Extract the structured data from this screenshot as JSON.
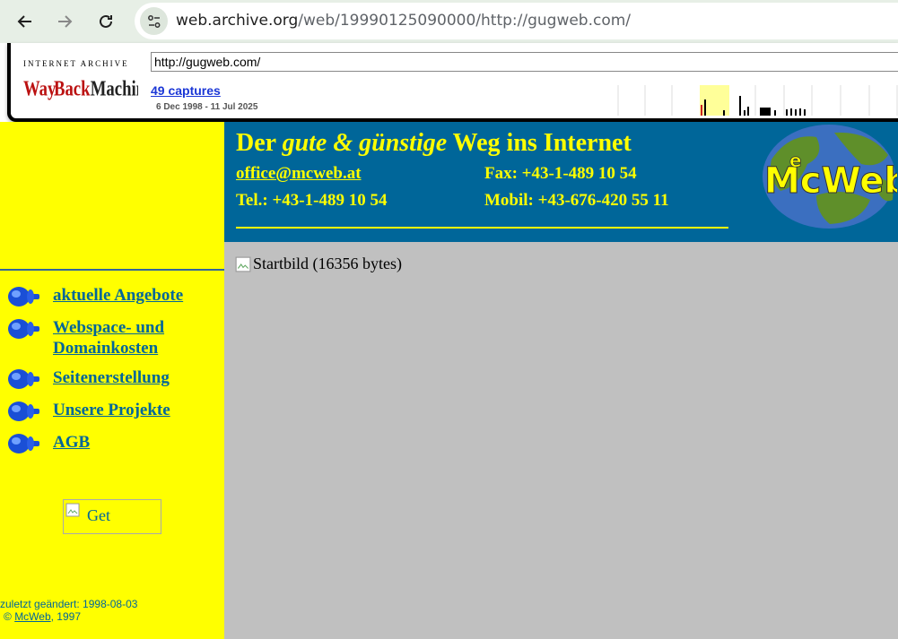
{
  "browser": {
    "url_host": "web.archive.org",
    "url_path": "/web/19990125090000/http://gugweb.com/"
  },
  "wayback": {
    "logo_top": "INTERNET ARCHIVE",
    "logo_alt": "WaybackMachine",
    "url_value": "http://gugweb.com/",
    "captures": "49 captures",
    "range": "6 Dec 1998 - 11 Jul 2025"
  },
  "header": {
    "tagline_pre": "Der ",
    "tagline_em": "gute & günstige",
    "tagline_post": " Weg ins Internet",
    "email": "office@mcweb.at",
    "fax": "Fax: +43-1-489 10 54",
    "tel": "Tel.: +43-1-489 10 54",
    "mobil": "Mobil: +43-676-420 55 11",
    "logo_text": "McWeb",
    "logo_e": "e",
    "colors": {
      "bg": "#006699",
      "text": "#ffff00"
    }
  },
  "nav": {
    "items": [
      {
        "label": "aktuelle Angebote"
      },
      {
        "label": "Webspace- und Domainkosten"
      },
      {
        "label": "Seitenerstellung"
      },
      {
        "label": "Unsere Projekte"
      },
      {
        "label": "AGB"
      }
    ]
  },
  "badge": {
    "alt": "Get Microsoft"
  },
  "main": {
    "image_alt": "Startbild (16356 bytes)"
  },
  "footer": {
    "updated": "zuletzt geändert: 1998-08-03",
    "copyright_symbol": "©",
    "owner": "McWeb",
    "year": ", 1997"
  }
}
